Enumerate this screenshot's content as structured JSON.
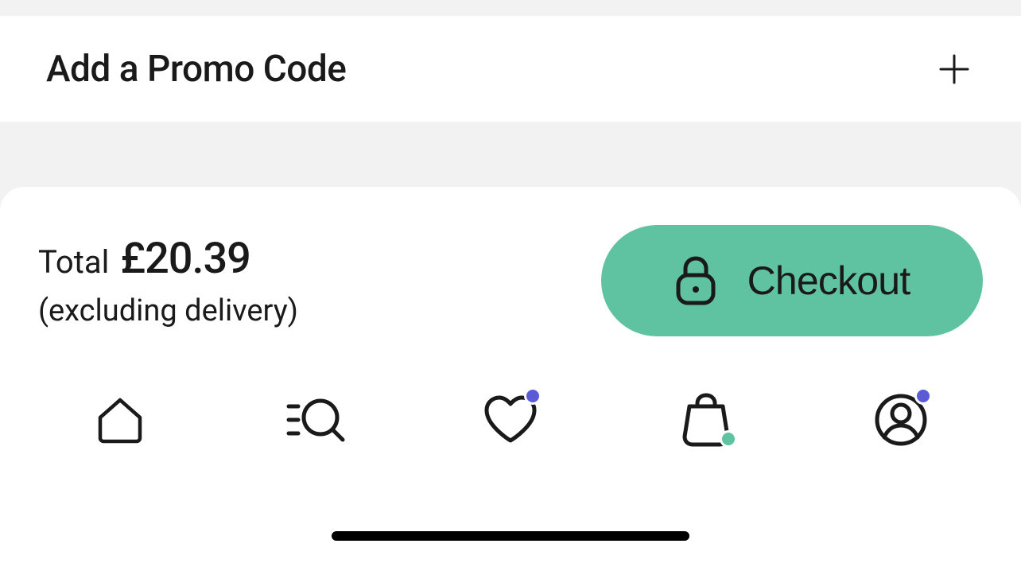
{
  "promo": {
    "label": "Add a Promo Code"
  },
  "summary": {
    "total_label": "Total",
    "total_amount": "£20.39",
    "note": "(excluding delivery)"
  },
  "checkout": {
    "label": "Checkout"
  },
  "colors": {
    "accent": "#5fc2a0",
    "badge": "#5b5bd6"
  }
}
